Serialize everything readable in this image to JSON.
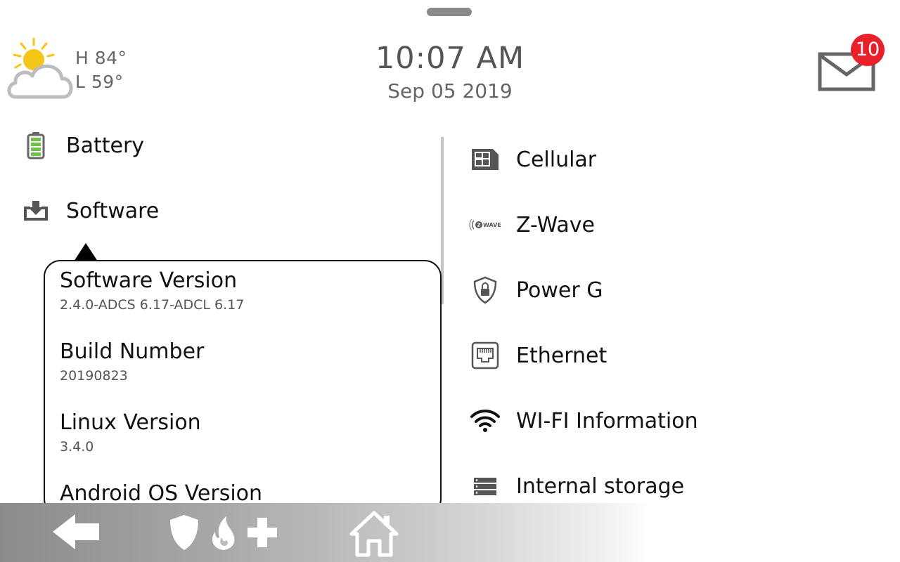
{
  "header": {
    "weather": {
      "icon": "partly-cloudy-icon",
      "high": "H 84°",
      "low": "L 59°"
    },
    "time": "10:07 AM",
    "date": "Sep 05 2019",
    "messages": {
      "icon": "envelope-icon",
      "count": "10"
    }
  },
  "left_menu": {
    "battery": {
      "icon": "battery-icon",
      "label": "Battery"
    },
    "software": {
      "icon": "download-tray-icon",
      "label": "Software"
    }
  },
  "software_popover": {
    "items": [
      {
        "title": "Software Version",
        "value": "2.4.0-ADCS 6.17-ADCL 6.17"
      },
      {
        "title": "Build Number",
        "value": "20190823"
      },
      {
        "title": "Linux Version",
        "value": "3.4.0"
      },
      {
        "title": "Android OS Version",
        "value": ""
      }
    ]
  },
  "right_menu": [
    {
      "icon": "cellular-chip-icon",
      "label": "Cellular"
    },
    {
      "icon": "zwave-icon",
      "label": "Z-Wave",
      "icon_text": "WAVE"
    },
    {
      "icon": "shield-lock-icon",
      "label": "Power G"
    },
    {
      "icon": "ethernet-port-icon",
      "label": "Ethernet"
    },
    {
      "icon": "wifi-icon",
      "label": "WI-FI Information"
    },
    {
      "icon": "storage-icon",
      "label": "Internal storage"
    }
  ],
  "bottom_bar": {
    "back": "back-arrow-icon",
    "emergency": [
      "shield-icon",
      "fire-icon",
      "medical-cross-icon"
    ],
    "home": "home-icon"
  },
  "colors": {
    "badge": "#e8202a",
    "sun": "#f5c518",
    "battery_green": "#6ec24a",
    "icon_gray": "#555555"
  }
}
